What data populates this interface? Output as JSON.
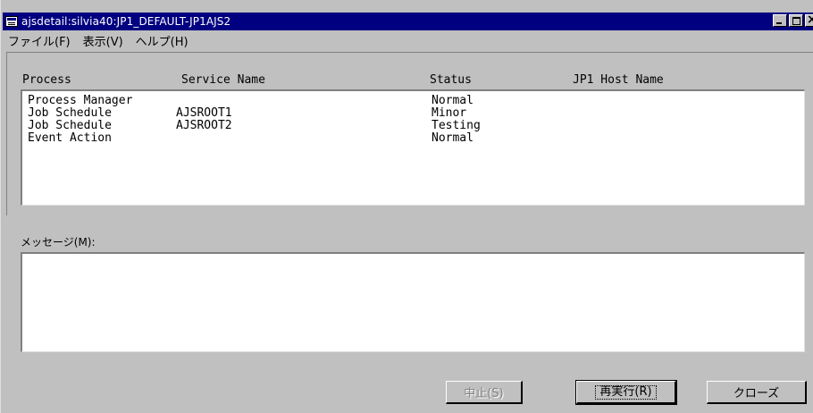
{
  "window": {
    "title": "ajsdetail:silvia40:JP1_DEFAULT-JP1AJS2"
  },
  "menu": {
    "items": [
      "ファイル(F)",
      "表示(V)",
      "ヘルプ(H)"
    ]
  },
  "table": {
    "headers": {
      "process": "Process",
      "service": "Service Name",
      "status": "Status",
      "host": "JP1 Host Name"
    },
    "rows": [
      {
        "process": "Process Manager",
        "service": "",
        "status": "Normal",
        "host": ""
      },
      {
        "process": "Job Schedule",
        "service": "AJSROOT1",
        "status": "Minor",
        "host": ""
      },
      {
        "process": "Job Schedule",
        "service": "AJSROOT2",
        "status": "Testing",
        "host": ""
      },
      {
        "process": "Event Action",
        "service": "",
        "status": "Normal",
        "host": ""
      }
    ]
  },
  "messages": {
    "label": "メッセージ(M):",
    "value": ""
  },
  "buttons": {
    "stop": "中止(S)",
    "rerun": "再実行(R)",
    "close": "クローズ"
  },
  "colors": {
    "titlebar": "#000080",
    "face": "#c0c0c0"
  }
}
